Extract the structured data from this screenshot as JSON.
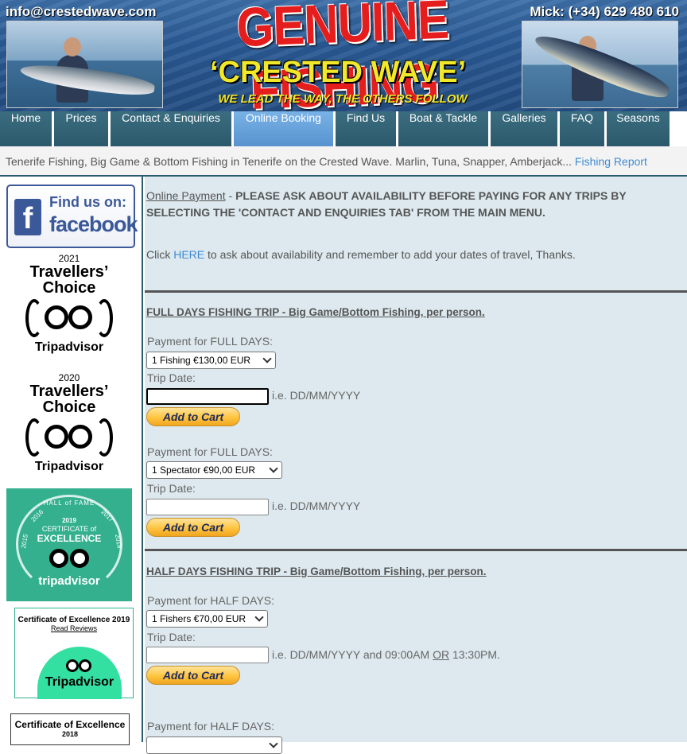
{
  "header": {
    "email": "info@crestedwave.com",
    "phone": "Mick: (+34) 629 480 610",
    "title": "GENUINE FISHING",
    "subtitle": "‘CRESTED WAVE’",
    "tagline": "WE LEAD THE WAY, THE OTHERS FOLLOW"
  },
  "nav": {
    "items": [
      {
        "label": "Home"
      },
      {
        "label": "Prices"
      },
      {
        "label": "Contact & Enquiries"
      },
      {
        "label": "Online Booking"
      },
      {
        "label": "Find Us"
      },
      {
        "label": "Boat & Tackle"
      },
      {
        "label": "Galleries"
      },
      {
        "label": "FAQ"
      },
      {
        "label": "Seasons"
      }
    ],
    "active": "Online Booking"
  },
  "infobar": {
    "text": "Tenerife Fishing, Big Game & Bottom Fishing in Tenerife on the Crested Wave. Marlin, Tuna, Snapper, Amberjack... ",
    "link": "Fishing Report"
  },
  "sidebar": {
    "facebook": {
      "line1": "Find us on:",
      "line2": "facebook",
      "logo": "f"
    },
    "tc2021": {
      "year": "2021",
      "line1": "Travellers’",
      "line2": "Choice",
      "brand": "Tripadvisor"
    },
    "tc2020": {
      "year": "2020",
      "line1": "Travellers’",
      "line2": "Choice",
      "brand": "Tripadvisor"
    },
    "hall_of_fame": {
      "hof": "HALL of FAME",
      "year": "2019",
      "line1": "CERTIFICATE of",
      "line2": "EXCELLENCE",
      "brand": "tripadvisor",
      "years": [
        "2015",
        "2016",
        "2017",
        "2018"
      ]
    },
    "coe2019": {
      "title": "Certificate of Excellence 2019",
      "link": "Read Reviews",
      "brand": "Tripadvisor"
    },
    "coe2018": {
      "title": "Certificate of Excellence",
      "year": "2018"
    }
  },
  "main": {
    "intro_link": "Online Payment",
    "intro_dash": " - ",
    "intro_bold": "PLEASE ASK ABOUT AVAILABILITY BEFORE PAYING FOR ANY TRIPS BY SELECTING THE 'CONTACT AND ENQUIRIES TAB' FROM THE MAIN MENU.",
    "click_pre": "Click ",
    "click_link": "HERE",
    "click_post": " to ask about availability and remember to add your dates of travel, Thanks.",
    "full_days": {
      "title": "FULL DAYS FISHING TRIP - Big Game/Bottom Fishing, per person.",
      "forms": [
        {
          "label": "Payment for FULL DAYS:",
          "selected": "1 Fishing €130,00 EUR",
          "date_label": "Trip Date:",
          "date_value": "",
          "hint": "i.e. DD/MM/YYYY",
          "button": "Add to Cart"
        },
        {
          "label": "Payment for FULL DAYS:",
          "selected": "1 Spectator €90,00 EUR",
          "date_label": "Trip Date:",
          "date_value": "",
          "hint": "i.e. DD/MM/YYYY",
          "button": "Add to Cart"
        }
      ]
    },
    "half_days": {
      "title": "HALF DAYS FISHING TRIP - Big Game/Bottom Fishing, per person.",
      "forms": [
        {
          "label": "Payment for HALF DAYS:",
          "selected": "1 Fishers €70,00 EUR",
          "date_label": "Trip Date:",
          "date_value": "",
          "hint_pre": "i.e. DD/MM/YYYY and 09:00AM ",
          "hint_or": "OR",
          "hint_post": " 13:30PM.",
          "button": "Add to Cart"
        },
        {
          "label": "Payment for HALF DAYS:"
        }
      ]
    }
  }
}
